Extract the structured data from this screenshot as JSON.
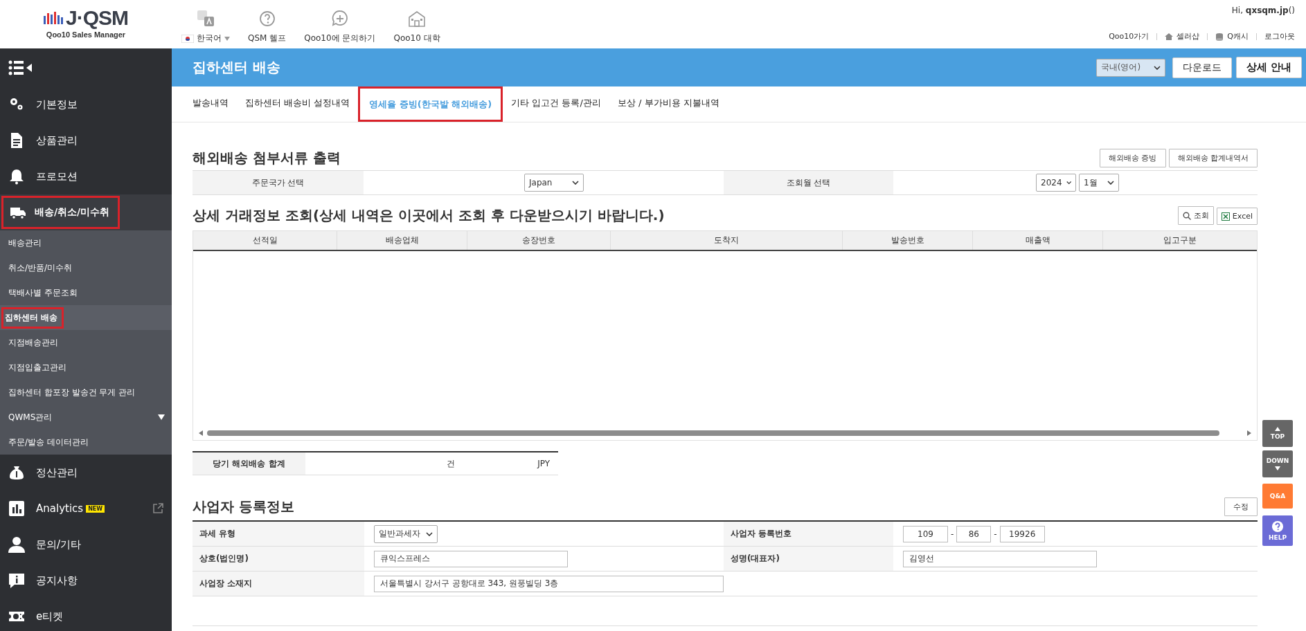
{
  "header": {
    "logo": {
      "text": "J·QSM",
      "subtitle": "Qoo10 Sales Manager"
    },
    "nav": [
      {
        "kind": "language",
        "label": "한국어"
      },
      {
        "kind": "help",
        "label": "QSM 헬프"
      },
      {
        "kind": "inquiry",
        "label": "Qoo10에 문의하기"
      },
      {
        "kind": "school",
        "label": "Qoo10 대학"
      }
    ],
    "greeting": "Hi, **qxsqm.jp**()",
    "links": [
      {
        "kind": "plain",
        "label": "Qoo10가기"
      },
      {
        "kind": "home",
        "label": "셀러샵"
      },
      {
        "kind": "coins",
        "label": "Q캐시"
      },
      {
        "kind": "plain",
        "label": "로그아웃"
      }
    ]
  },
  "sidebar": {
    "items": [
      {
        "kind": "gears",
        "label": "기본정보",
        "selected": false,
        "highlighted": false
      },
      {
        "kind": "document",
        "label": "상품관리",
        "selected": false,
        "highlighted": false
      },
      {
        "kind": "bell",
        "label": "프로모션",
        "selected": false,
        "highlighted": false
      },
      {
        "kind": "truck",
        "label": "배송/취소/미수취",
        "selected": true,
        "highlighted": true,
        "expanded": true,
        "children": [
          {
            "label": "배송관리",
            "selected": false,
            "highlighted": false
          },
          {
            "label": "취소/반품/미수취",
            "selected": false,
            "highlighted": false
          },
          {
            "label": "택배사별 주문조회",
            "selected": false,
            "highlighted": false
          },
          {
            "label": "집하센터 배송",
            "selected": true,
            "highlighted": true
          },
          {
            "label": "지점배송관리",
            "selected": false,
            "highlighted": false
          },
          {
            "label": "지점입출고관리",
            "selected": false,
            "highlighted": false
          },
          {
            "label": "집하센터 합포장 발송건 무게 관리",
            "selected": false,
            "highlighted": false
          },
          {
            "label": "QWMS관리",
            "selected": false,
            "highlighted": false,
            "has_submenu": true
          },
          {
            "label": "주문/발송 데이터관리",
            "selected": false,
            "highlighted": false
          }
        ]
      },
      {
        "kind": "moneybag",
        "label": "정산관리",
        "selected": false,
        "highlighted": false
      },
      {
        "kind": "chart",
        "label": "Analytics",
        "badge": "NEW",
        "external": true,
        "selected": false,
        "highlighted": false
      },
      {
        "kind": "person",
        "label": "문의/기타",
        "selected": false,
        "highlighted": false
      },
      {
        "kind": "notice",
        "label": "공지사항",
        "selected": false,
        "highlighted": false
      },
      {
        "kind": "ticket",
        "label": "e티켓",
        "selected": false,
        "highlighted": false
      }
    ]
  },
  "page": {
    "title": "집하센터 배송",
    "region": "국내(영어)",
    "buttons": [
      "다운로드",
      "상세 안내"
    ]
  },
  "tabs": [
    {
      "label": "발송내역",
      "selected": false,
      "highlighted": false
    },
    {
      "label": "집하센터 배송비 설정내역",
      "selected": false,
      "highlighted": false
    },
    {
      "label": "영세율 증빙(한국발 해외배송)",
      "selected": true,
      "highlighted": true
    },
    {
      "label": "기타 입고건 등록/관리",
      "selected": false,
      "highlighted": false
    },
    {
      "label": "보상 / 부가비용 지불내역",
      "selected": false,
      "highlighted": false
    }
  ],
  "documents": {
    "title": "해외배송 첨부서류 출력",
    "buttons": [
      "해외배송 증빙",
      "해외배송 합계내역서"
    ],
    "filters": [
      {
        "label": "주문국가 선택",
        "selects": [
          "Japan"
        ]
      },
      {
        "label": "조회월 선택",
        "selects": [
          "2024",
          "1월"
        ]
      }
    ]
  },
  "transactions": {
    "title": "상세 거래정보 조회(상세 내역은 이곳에서 조회 후 다운받으시기 바랍니다.)",
    "buttons": [
      {
        "kind": "search",
        "label": "조회"
      },
      {
        "kind": "excel",
        "label": "Excel"
      }
    ],
    "columns": [
      "선적일",
      "배송업체",
      "송장번호",
      "도착지",
      "발송번호",
      "매출액",
      "입고구분"
    ],
    "summary": {
      "label": "당기 해외배송 합계",
      "count_unit": "건",
      "currency": "JPY"
    }
  },
  "business": {
    "title": "사업자 등록정보",
    "edit_button": "수정",
    "rows": [
      {
        "fields": [
          {
            "label": "과세 유형",
            "kind": "select",
            "value": "일반과세자"
          },
          {
            "label": "사업자 등록번호",
            "kind": "parts",
            "parts": [
              "109",
              "86",
              "19926"
            ],
            "separators": [
              "-",
              "-"
            ]
          }
        ]
      },
      {
        "fields": [
          {
            "label": "상호(법인명)",
            "kind": "input",
            "value": "큐익스프레스"
          },
          {
            "label": "성명(대표자)",
            "kind": "input",
            "value": "김영선"
          }
        ]
      },
      {
        "fields": [
          {
            "label": "사업장 소재지",
            "kind": "wide",
            "value": "서울특별시 강서구 공항대로 343, 원풍빌딩 3층"
          }
        ]
      }
    ]
  },
  "float_buttons": [
    {
      "kind": "top",
      "label": "TOP"
    },
    {
      "kind": "down",
      "label": "DOWN"
    },
    {
      "kind": "qa",
      "label": "Q&A"
    },
    {
      "kind": "help",
      "label": "HELP"
    }
  ]
}
